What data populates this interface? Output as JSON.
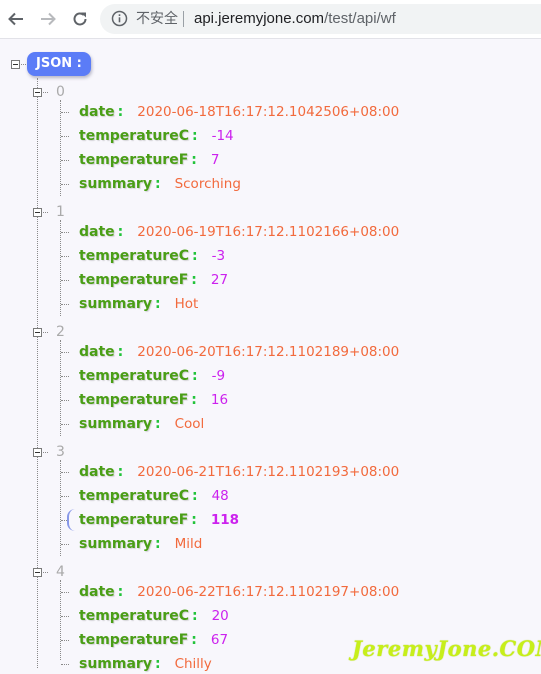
{
  "browser": {
    "back_icon": "arrow-left-icon",
    "forward_icon": "arrow-right-icon",
    "reload_icon": "reload-icon",
    "security_icon": "info-icon",
    "security_label": "不安全",
    "url_host": "api.jeremyjone.com",
    "url_path": "/test/api/wf"
  },
  "viewer": {
    "root_label": "JSON :",
    "key_separator": ":",
    "items": [
      {
        "index": "0",
        "date": "2020-06-18T16:17:12.1042506+08:00",
        "temperatureC": "-14",
        "temperatureF": "7",
        "summary": "Scorching"
      },
      {
        "index": "1",
        "date": "2020-06-19T16:17:12.1102166+08:00",
        "temperatureC": "-3",
        "temperatureF": "27",
        "summary": "Hot"
      },
      {
        "index": "2",
        "date": "2020-06-20T16:17:12.1102189+08:00",
        "temperatureC": "-9",
        "temperatureF": "16",
        "summary": "Cool"
      },
      {
        "index": "3",
        "date": "2020-06-21T16:17:12.1102193+08:00",
        "temperatureC": "48",
        "temperatureF": "118",
        "summary": "Mild"
      },
      {
        "index": "4",
        "date": "2020-06-22T16:17:12.1102197+08:00",
        "temperatureC": "20",
        "temperatureF": "67",
        "summary": "Chilly"
      }
    ],
    "keys": {
      "date": "date",
      "temperatureC": "temperatureC",
      "temperatureF": "temperatureF",
      "summary": "summary"
    },
    "hovered": {
      "item": 3,
      "key": "temperatureF"
    }
  },
  "watermark": "JeremyJone.COM",
  "colors": {
    "key": "#4a9e16",
    "colon": "#22c33a",
    "string": "#f26a3d",
    "number": "#cc22ee",
    "root_badge": "#5b7cf7",
    "background": "#f8f7fc"
  }
}
